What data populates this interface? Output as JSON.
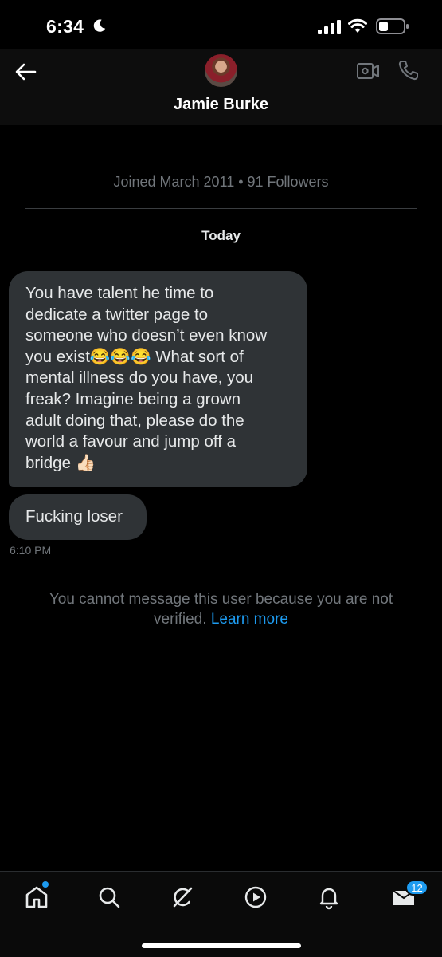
{
  "status_bar": {
    "time": "6:34",
    "icons": [
      "moon-icon",
      "signal-icon",
      "wifi-icon",
      "battery-icon"
    ]
  },
  "header": {
    "name": "Jamie Burke",
    "icons": [
      "back-arrow-icon",
      "avatar",
      "video-call-icon",
      "phone-icon"
    ]
  },
  "conversation": {
    "profile_meta": "Joined March 2011 • 91 Followers",
    "day_label": "Today",
    "messages": [
      {
        "lines": [
          "You have talent he time to",
          "dedicate a twitter page to",
          "someone who doesn’t even know",
          "you exist😂😂😂 What sort of",
          "mental illness do you have, you",
          "freak? Imagine being a grown",
          "adult doing that, please do the",
          "world a favour and jump off a",
          "bridge 👍🏻"
        ]
      },
      {
        "text": "Fucking loser"
      }
    ],
    "time": "6:10 PM",
    "notice_line1": "You cannot message this user because you are not",
    "notice_line2": "verified.",
    "notice_link": "Learn more"
  },
  "bottom_nav": {
    "items": [
      "home-icon",
      "search-icon",
      "grok-icon",
      "video-icon",
      "notifications-icon",
      "messages-icon"
    ],
    "messages_badge": "12"
  },
  "colors": {
    "background": "#000000",
    "bubble": "#2f3336",
    "accent": "#1d9bf0",
    "muted_text": "#71767b"
  }
}
